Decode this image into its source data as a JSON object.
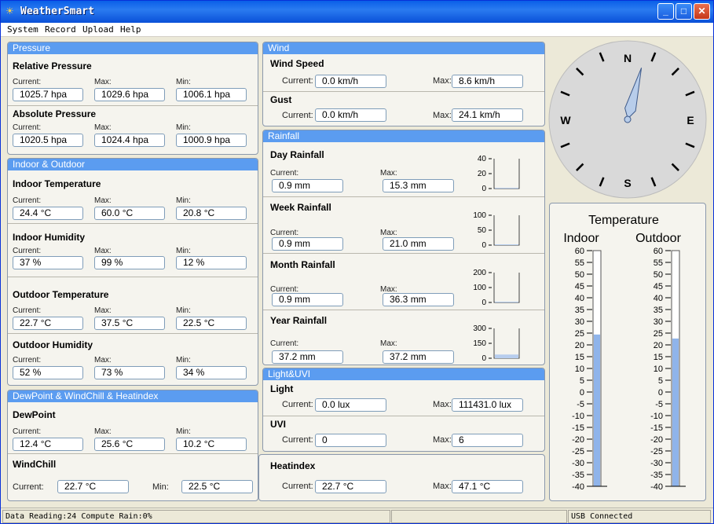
{
  "window": {
    "title": "WeatherSmart",
    "minimize": "_",
    "maximize": "□",
    "close": "✕",
    "icon": "weather-app-icon"
  },
  "menu": [
    "System",
    "Record",
    "Upload",
    "Help"
  ],
  "pressure": {
    "title": "Pressure",
    "relative": {
      "title": "Relative Pressure",
      "current": "1025.7 hpa",
      "max": "1029.6 hpa",
      "min": "1006.1 hpa"
    },
    "absolute": {
      "title": "Absolute Pressure",
      "current": "1020.5 hpa",
      "max": "1024.4 hpa",
      "min": "1000.9 hpa"
    }
  },
  "indoor_outdoor": {
    "title": "Indoor & Outdoor",
    "indoor_temp": {
      "title": "Indoor Temperature",
      "current": "24.4 °C",
      "max": "60.0 °C",
      "min": "20.8 °C"
    },
    "indoor_hum": {
      "title": "Indoor Humidity",
      "current": "37 %",
      "max": "99 %",
      "min": "12 %"
    },
    "outdoor_temp": {
      "title": "Outdoor Temperature",
      "current": "22.7 °C",
      "max": "37.5 °C",
      "min": "22.5 °C"
    },
    "outdoor_hum": {
      "title": "Outdoor Humidity",
      "current": "52 %",
      "max": "73 %",
      "min": "34 %"
    }
  },
  "dewpoint": {
    "title": "DewPoint & WindChill & Heatindex",
    "dew": {
      "title": "DewPoint",
      "current": "12.4 °C",
      "max": "25.6 °C",
      "min": "10.2 °C"
    },
    "windchill": {
      "title": "WindChill",
      "current": "22.7 °C",
      "min": "22.5 °C"
    },
    "heatindex": {
      "title": "Heatindex",
      "current": "22.7 °C",
      "max": "47.1 °C"
    }
  },
  "labels": {
    "current": "Current:",
    "max": "Max:",
    "min": "Min:"
  },
  "wind": {
    "title": "Wind",
    "speed": {
      "title": "Wind Speed",
      "current": "0.0 km/h",
      "max": "8.6 km/h"
    },
    "gust": {
      "title": "Gust",
      "current": "0.0 km/h",
      "max": "24.1 km/h"
    }
  },
  "rainfall": {
    "title": "Rainfall",
    "day": {
      "title": "Day Rainfall",
      "current": "0.9 mm",
      "max": "15.3 mm",
      "ticks": [
        "40",
        "20",
        "0"
      ],
      "scale_max": 40,
      "value": 0.9
    },
    "week": {
      "title": "Week Rainfall",
      "current": "0.9 mm",
      "max": "21.0 mm",
      "ticks": [
        "100",
        "50",
        "0"
      ],
      "scale_max": 100,
      "value": 0.9
    },
    "month": {
      "title": "Month Rainfall",
      "current": "0.9 mm",
      "max": "36.3 mm",
      "ticks": [
        "200",
        "100",
        "0"
      ],
      "scale_max": 200,
      "value": 0.9
    },
    "year": {
      "title": "Year Rainfall",
      "current": "37.2 mm",
      "max": "37.2 mm",
      "ticks": [
        "300",
        "150",
        "0"
      ],
      "scale_max": 300,
      "value": 37.2
    }
  },
  "light": {
    "title": "Light&UVI",
    "light": {
      "title": "Light",
      "current": "0.0 lux",
      "max": "111431.0 lux"
    },
    "uvi": {
      "title": "UVI",
      "current": "0",
      "max": "6"
    }
  },
  "compass": {
    "n": "N",
    "e": "E",
    "s": "S",
    "w": "W",
    "direction_deg": 15
  },
  "temperature_gauge": {
    "title": "Temperature",
    "indoor_label": "Indoor",
    "outdoor_label": "Outdoor",
    "ticks": [
      "60",
      "55",
      "50",
      "45",
      "40",
      "35",
      "30",
      "25",
      "20",
      "15",
      "10",
      "5",
      "0",
      "-5",
      "-10",
      "-15",
      "-20",
      "-25",
      "-30",
      "-35",
      "-40"
    ],
    "indoor_value": 24.4,
    "outdoor_value": 22.7,
    "fill_color": "#8fb4ea"
  },
  "status": {
    "reading": "Data Reading:24 Compute Rain:0%",
    "usb": "USB Connected"
  }
}
